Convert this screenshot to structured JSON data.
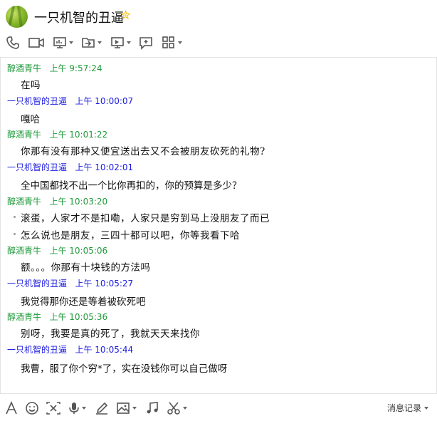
{
  "header": {
    "title": "一只机智的丑逼",
    "star_icon": "star-icon"
  },
  "toolbar": {
    "icons": [
      "phone-icon",
      "video-icon",
      "screen-share-icon",
      "file-transfer-icon",
      "remote-desktop-icon",
      "add-chat-icon",
      "apps-grid-icon"
    ]
  },
  "messages": [
    {
      "sender": "醇酒青牛",
      "time": "上午 9:57:24",
      "color": "#1f9b3b",
      "lines": [
        "在吗"
      ]
    },
    {
      "sender": "一只机智的丑逼",
      "time": "上午 10:00:07",
      "color": "#1c1ce0",
      "lines": [
        "嘎哈"
      ]
    },
    {
      "sender": "醇酒青牛",
      "time": "上午 10:01:22",
      "color": "#1f9b3b",
      "lines": [
        "你那有没有那种又便宜送出去又不会被朋友砍死的礼物?"
      ]
    },
    {
      "sender": "一只机智的丑逼",
      "time": "上午 10:02:01",
      "color": "#1c1ce0",
      "lines": [
        "全中国都找不出一个比你再扣的，你的预算是多少？"
      ]
    },
    {
      "sender": "醇酒青牛",
      "time": "上午 10:03:20",
      "color": "#1f9b3b",
      "lines": [
        "滚蛋，人家才不是扣嘞，人家只是穷到马上没朋友了而已",
        "怎么说也是朋友，三四十都可以吧，你等我看下哈"
      ]
    },
    {
      "sender": "醇酒青牛",
      "time": "上午 10:05:06",
      "color": "#1f9b3b",
      "lines": [
        "额。。。你那有十块钱的方法吗"
      ]
    },
    {
      "sender": "一只机智的丑逼",
      "time": "上午 10:05:27",
      "color": "#1c1ce0",
      "lines": [
        "我觉得那你还是等着被砍死吧"
      ]
    },
    {
      "sender": "醇酒青牛",
      "time": "上午 10:05:36",
      "color": "#1f9b3b",
      "lines": [
        "别呀，我要是真的死了，我就天天来找你"
      ]
    },
    {
      "sender": "一只机智的丑逼",
      "time": "上午 10:05:44",
      "color": "#1c1ce0",
      "lines": [
        "我曹，服了你个穷*了，实在没钱你可以自己做呀"
      ]
    }
  ],
  "input_bar": {
    "icons": [
      "font-icon",
      "emoji-icon",
      "screenshot-icon",
      "voice-icon",
      "handwriting-icon",
      "image-icon",
      "music-icon",
      "scissors-icon"
    ],
    "history_label": "消息记录"
  }
}
